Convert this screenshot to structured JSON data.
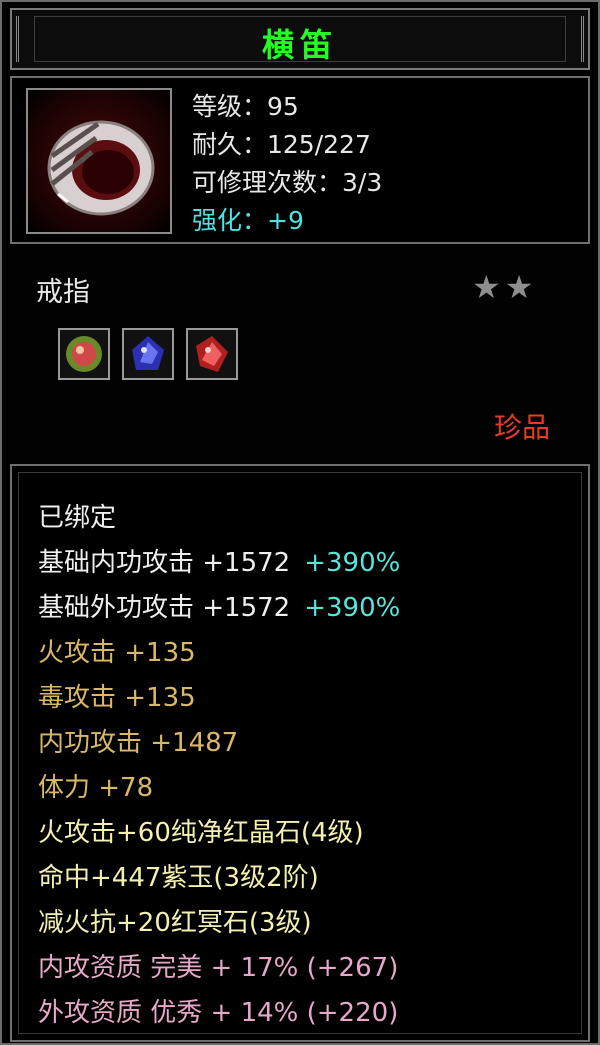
{
  "item": {
    "name": "横笛",
    "level": "等级：95",
    "durability": "耐久：125/227",
    "repairs": "可修理次数：3/3",
    "enhance": "强化：+9",
    "type": "戒指",
    "stars": "★★",
    "rarity": "珍品",
    "icon": "ring-icon",
    "gems": [
      {
        "icon": "green-gem-icon",
        "color": "#c84a4a"
      },
      {
        "icon": "blue-gem-icon",
        "color": "#3a44c8"
      },
      {
        "icon": "red-gem-icon",
        "color": "#c82a2a"
      }
    ]
  },
  "stats": {
    "bound": "已绑定",
    "base_inner": {
      "label": "基础内功攻击 +1572",
      "bonus": "+390%"
    },
    "base_outer": {
      "label": "基础外功攻击 +1572",
      "bonus": "+390%"
    },
    "fire_attack": "火攻击 +135",
    "poison_attack": "毒攻击 +135",
    "inner_attack": "内功攻击 +1487",
    "stamina": "体力 +78",
    "gem_fire": "火攻击+60纯净红晶石(4级)",
    "gem_accuracy": "命中+447紫玉(3级2阶)",
    "gem_resist": "减火抗+20红冥石(3级)",
    "quality_inner": "内攻资质 完美 + 17% (+267)",
    "quality_outer": "外攻资质 优秀 + 14% (+220)"
  },
  "colors": {
    "title": "#22ff22",
    "enhance": "#4fe0e0",
    "rarity": "#e63a2a",
    "gold_stat": "#d9b868",
    "bonus": "#58e4dc",
    "gem_line": "#f3f0b0",
    "quality": "#e6a8c8"
  }
}
